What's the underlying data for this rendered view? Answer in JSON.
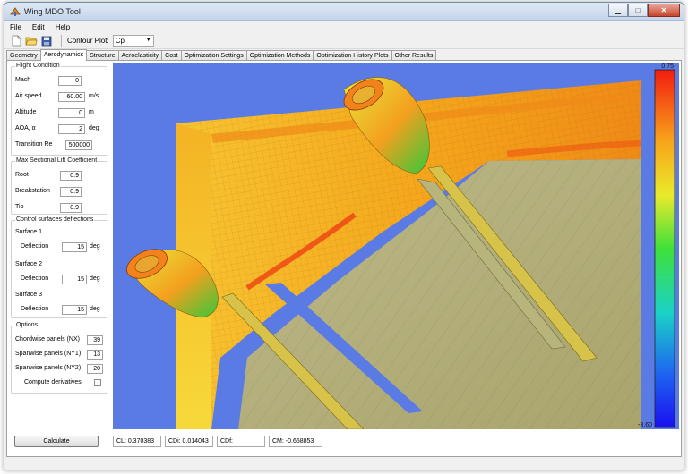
{
  "window": {
    "title": "Wing MDO Tool"
  },
  "menu": [
    "File",
    "Edit",
    "Help"
  ],
  "toolbar": {
    "contour_label": "Contour Plot:",
    "contour_value": "Cp"
  },
  "tabs": [
    "Geometry",
    "Aerodynamics",
    "Structure",
    "Aeroelasticity",
    "Cost",
    "Optimization Settings",
    "Optimization Methods",
    "Optimization History Plots",
    "Other Results"
  ],
  "active_tab": "Aerodynamics",
  "flight_condition": {
    "title": "Flight Condition",
    "mach_label": "Mach",
    "mach_value": "0",
    "airspeed_label": "Air speed",
    "airspeed_value": "60.00",
    "airspeed_unit": "m/s",
    "altitude_label": "Altitude",
    "altitude_value": "0",
    "altitude_unit": "m",
    "aoa_label": "AOA, α",
    "aoa_value": "2",
    "aoa_unit": "deg",
    "transition_label": "Transition Re",
    "transition_value": "500000"
  },
  "max_lift": {
    "title": "Max Sectional Lift Coefficient",
    "root_label": "Root",
    "root_value": "0.9",
    "break_label": "Breakstation",
    "break_value": "0.9",
    "tip_label": "Tip",
    "tip_value": "0.9"
  },
  "control_surfaces": {
    "title": "Control surfaces deflections",
    "s1_label": "Surface 1",
    "s2_label": "Surface 2",
    "s3_label": "Surface 3",
    "deflection_label": "Deflection",
    "s1_value": "15",
    "s2_value": "15",
    "s3_value": "15",
    "unit": "deg"
  },
  "options": {
    "title": "Options",
    "nx_label": "Chordwise panels (NX)",
    "nx_value": "39",
    "ny1_label": "Spanwise panels (NY1)",
    "ny1_value": "13",
    "ny2_label": "Spanwise panels (NY2)",
    "ny2_value": "20",
    "derivatives_label": "Compute derivatives",
    "derivatives_checked": false
  },
  "colorbar": {
    "max_label": "0.75",
    "min_label": "-3.60"
  },
  "status": {
    "calculate_label": "Calculate",
    "cl": "CL: 0.370383",
    "cdi": "CDi: 0.014043",
    "cdf": "CDf:",
    "cm": "CM: -0.658853"
  },
  "colors": {
    "viewport_bg": "#5b7be4",
    "wing_orange": "#f5a41c",
    "wing_interior": "#b8b57e"
  }
}
